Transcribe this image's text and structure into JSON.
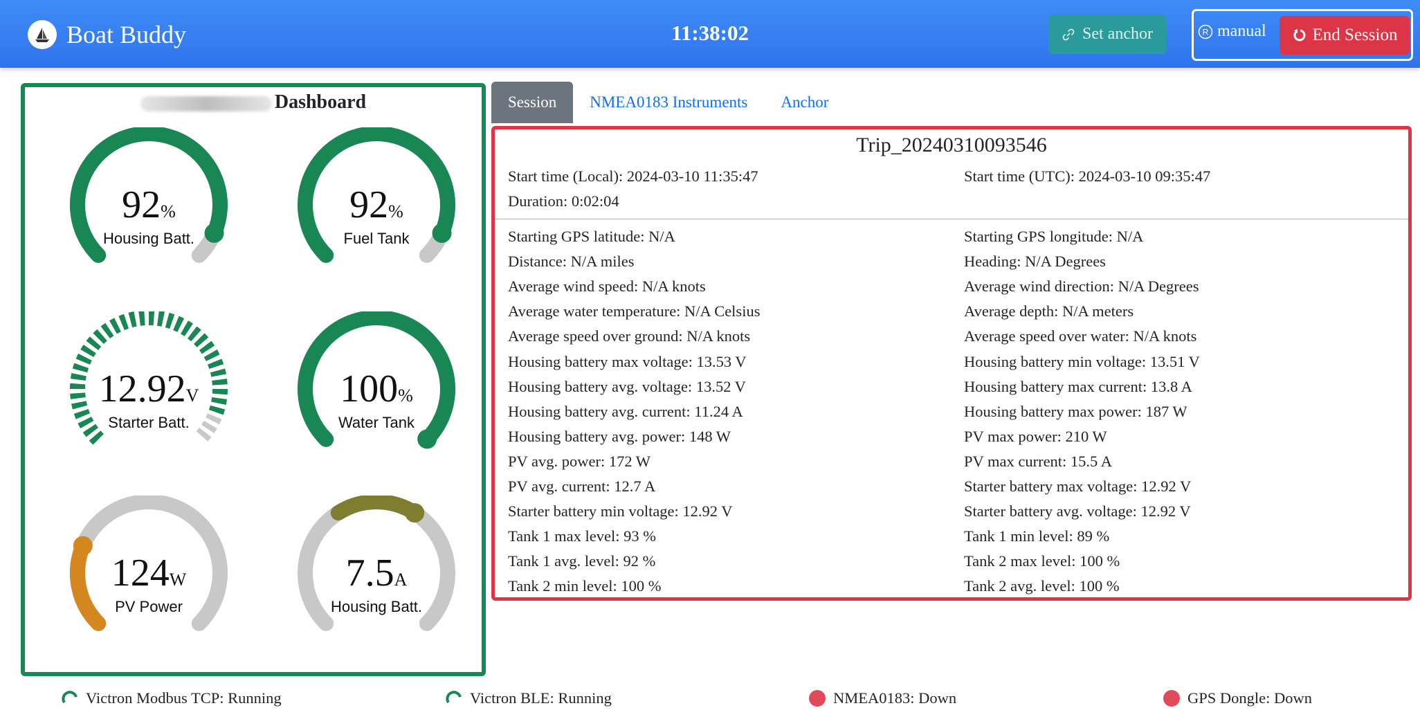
{
  "header": {
    "app_name": "Boat Buddy",
    "clock": "11:38:02",
    "set_anchor_label": "Set anchor",
    "mode_label": "manual",
    "end_session_label": "End Session"
  },
  "dashboard": {
    "title": "Dashboard",
    "gauges": [
      {
        "value": "92",
        "unit": "%",
        "label": "Housing Batt.",
        "fill": 0.92,
        "color": "#198754",
        "style": "solid"
      },
      {
        "value": "92",
        "unit": "%",
        "label": "Fuel Tank",
        "fill": 0.92,
        "color": "#198754",
        "style": "solid"
      },
      {
        "value": "12.92",
        "unit": "V",
        "label": "Starter Batt.",
        "fill": 0.92,
        "color": "#198754",
        "style": "segmented"
      },
      {
        "value": "100",
        "unit": "%",
        "label": "Water Tank",
        "fill": 1.0,
        "color": "#198754",
        "style": "solid"
      },
      {
        "value": "124",
        "unit": "W",
        "label": "PV Power",
        "fill": 0.25,
        "color": "#d4861f",
        "style": "solid"
      },
      {
        "value": "7.5",
        "unit": "A",
        "label": "Housing Batt.",
        "fill": 0.62,
        "fill_start": 0.38,
        "color": "#7f7d2f",
        "style": "solid"
      }
    ],
    "track_color": "#c8c8c8"
  },
  "tabs": [
    "Session",
    "NMEA0183 Instruments",
    "Anchor"
  ],
  "session": {
    "trip_name": "Trip_20240310093546",
    "start_local": "Start time (Local): 2024-03-10 11:35:47",
    "start_utc": "Start time (UTC): 2024-03-10 09:35:47",
    "duration": "Duration: 0:02:04",
    "left_stats": [
      "Starting GPS latitude: N/A",
      "Distance: N/A miles",
      "Average wind speed: N/A knots",
      "Average water temperature: N/A Celsius",
      "Average speed over ground: N/A knots",
      "Housing battery max voltage: 13.53 V",
      "Housing battery avg. voltage: 13.52 V",
      "Housing battery avg. current: 11.24 A",
      "Housing battery avg. power: 148 W",
      "PV avg. power: 172 W",
      "PV avg. current: 12.7 A",
      "Starter battery min voltage: 12.92 V",
      "Tank 1 max level: 93 %",
      "Tank 1 avg. level: 92 %",
      "Tank 2 min level: 100 %"
    ],
    "right_stats": [
      "Starting GPS longitude: N/A",
      "Heading: N/A Degrees",
      "Average wind direction: N/A Degrees",
      "Average depth: N/A meters",
      "Average speed over water: N/A knots",
      "Housing battery min voltage: 13.51 V",
      "Housing battery max current: 13.8 A",
      "Housing battery max power: 187 W",
      "PV max power: 210 W",
      "PV max current: 15.5 A",
      "Starter battery max voltage: 12.92 V",
      "Starter battery avg. voltage: 12.92 V",
      "Tank 1 min level: 89 %",
      "Tank 2 max level: 100 %",
      "Tank 2 avg. level: 100 %"
    ]
  },
  "services": [
    {
      "label": "Victron Modbus TCP: Running",
      "state": "running"
    },
    {
      "label": "Victron BLE: Running",
      "state": "running"
    },
    {
      "label": "NMEA0183: Down",
      "state": "down"
    },
    {
      "label": "GPS Dongle: Down",
      "state": "down"
    }
  ],
  "colors": {
    "primary": "#2f74ec",
    "success": "#198754",
    "danger": "#dc3545",
    "info": "#2a9a9a",
    "secondary": "#6c757d"
  }
}
